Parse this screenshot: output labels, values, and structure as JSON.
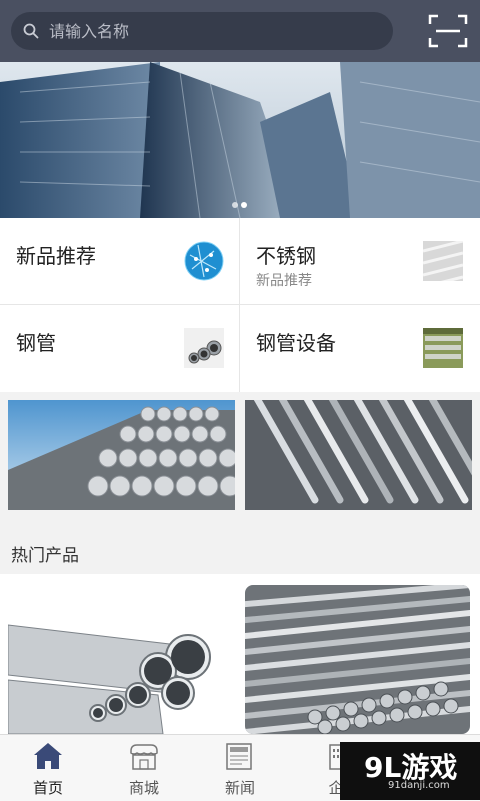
{
  "search": {
    "placeholder": "请输入名称"
  },
  "banner": {
    "pages": 2,
    "active_page": 1
  },
  "categories": [
    {
      "title": "新品推荐",
      "subtitle": ""
    },
    {
      "title": "不锈钢",
      "subtitle": "新品推荐"
    },
    {
      "title": "钢管",
      "subtitle": ""
    },
    {
      "title": "钢管设备",
      "subtitle": ""
    }
  ],
  "hot": {
    "title": "热门产品"
  },
  "tabbar": {
    "items": [
      {
        "label": "首页",
        "icon": "home-icon",
        "active": true
      },
      {
        "label": "商城",
        "icon": "store-icon",
        "active": false
      },
      {
        "label": "新闻",
        "icon": "news-icon",
        "active": false
      },
      {
        "label": "企",
        "icon": "company-icon",
        "active": false
      }
    ]
  },
  "watermark": {
    "logo_text": "9L游戏",
    "url_text": "91danji.com"
  },
  "colors": {
    "header": "#4a5061",
    "search_bg": "#363c4b",
    "accent": "#3a4a78"
  }
}
